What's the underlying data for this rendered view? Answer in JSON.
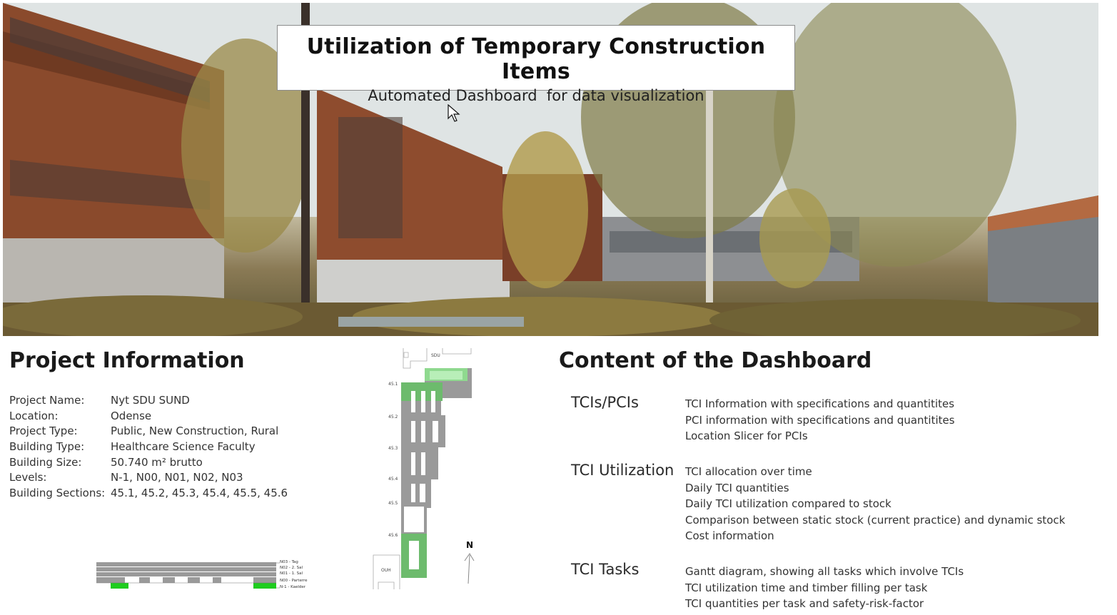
{
  "hero": {
    "title": "Utilization of Temporary Construction Items",
    "subtitle": "Automated Dashboard  for data visualization"
  },
  "project": {
    "heading": "Project Information",
    "rows": [
      {
        "label": "Project Name:",
        "value": "Nyt SDU SUND"
      },
      {
        "label": "Location:",
        "value": "Odense"
      },
      {
        "label": "Project Type:",
        "value": "Public, New Construction, Rural"
      },
      {
        "label": "Building Type:",
        "value": "Healthcare Science Faculty"
      },
      {
        "label": "Building Size:",
        "value": "50.740 m² brutto"
      },
      {
        "label": "Levels:",
        "value": "N-1, N00, N01, N02, N03"
      },
      {
        "label": "Building Sections:",
        "value": "45.1, 45.2, 45.3, 45.4, 45.5, 45.6"
      }
    ]
  },
  "section_plan": {
    "levels": [
      "N03 - Tag",
      "N02 - 2. Sal",
      "N01 - 1. Sal",
      "N00 - Parterre",
      "N-1 - Kaelder"
    ]
  },
  "site_plan": {
    "top_label": "SDU",
    "bottom_label": "OUH",
    "north_label": "N",
    "section_labels": [
      "45.1",
      "45.2",
      "45.3",
      "45.4",
      "45.5",
      "45.6"
    ]
  },
  "dashboard": {
    "heading": "Content of the Dashboard",
    "categories": [
      {
        "label": "TCIs/PCIs",
        "items": [
          "TCI Information with specifications and quantitites",
          "PCI information with specifications and quantitites",
          "Location Slicer for PCIs"
        ]
      },
      {
        "label": "TCI Utilization",
        "items": [
          "TCI allocation over time",
          "Daily TCI quantities",
          "Daily TCI utilization compared to stock",
          "Comparison between static stock (current practice) and dynamic stock",
          "Cost information"
        ]
      },
      {
        "label": "TCI Tasks",
        "items": [
          "Gantt diagram, showing all tasks which involve TCIs",
          "TCI utilization time and timber filling per task",
          "TCI quantities per task and safety-risk-factor"
        ]
      }
    ]
  },
  "colors": {
    "highlight_green": "#8fd98f",
    "dark_green": "#6dbb6d",
    "bright_green": "#1fcc1f",
    "building_gray": "#9a9a9a"
  }
}
